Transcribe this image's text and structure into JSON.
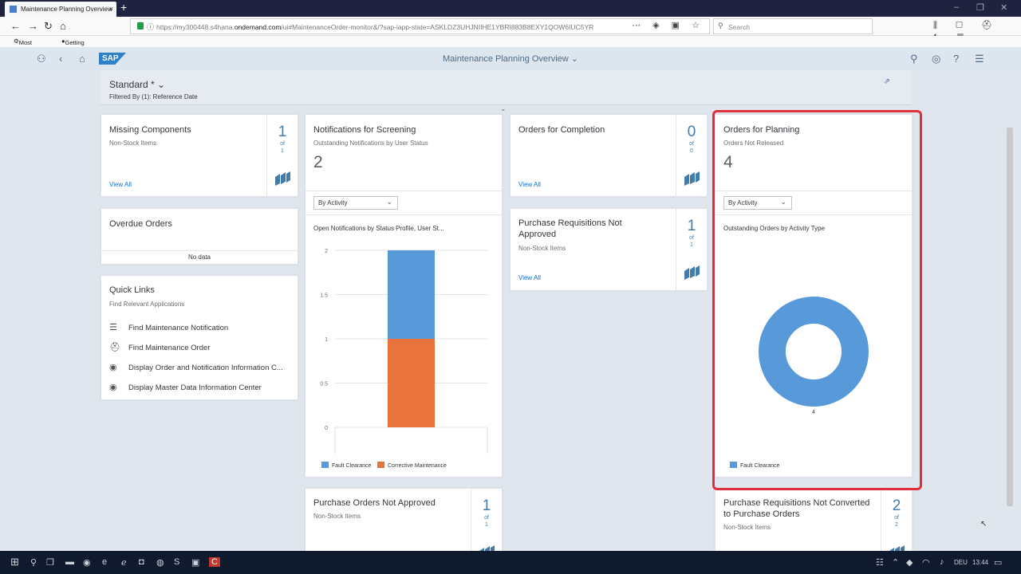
{
  "browser": {
    "tab_title": "Maintenance Planning Overview",
    "tab_close": "×",
    "new_tab": "+",
    "url_prefix": "https://my300448.s4hana.",
    "url_domain": "ondemand.com",
    "url_path": "/ui#MaintenanceOrder-monitor&/?sap-iapp-state=ASKLDZ3UHJNIIHE1YBRI883B8EXY1QOW6IUC5YR",
    "search_placeholder": "Search",
    "bookmarks": [
      "Most Visited",
      "Getting Started"
    ]
  },
  "shell": {
    "logo": "SAP",
    "title": "Maintenance Planning Overview"
  },
  "header": {
    "variant": "Standard *",
    "filter_text": "Filtered By (1): Reference Date"
  },
  "cards": {
    "missing_components": {
      "title": "Missing Components",
      "subtitle": "Non-Stock Items",
      "count": "1",
      "of": "of",
      "total": "1",
      "link": "View All"
    },
    "notifications": {
      "title": "Notifications for Screening",
      "subtitle": "Outstanding Notifications by User Status",
      "kpi": "2",
      "dropdown": "By Activity",
      "chart_title": "Open Notifications by Status Profile, User St..."
    },
    "orders_completion": {
      "title": "Orders for Completion",
      "count": "0",
      "of": "of",
      "total": "0",
      "link": "View All"
    },
    "orders_planning": {
      "title": "Orders for Planning",
      "subtitle": "Orders Not Released",
      "kpi": "4",
      "dropdown": "By Activity",
      "chart_title": "Outstanding Orders by Activity Type"
    },
    "overdue_orders": {
      "title": "Overdue Orders",
      "no_data": "No data"
    },
    "quick_links": {
      "title": "Quick Links",
      "subtitle": "Find Relevant Applications",
      "items": [
        {
          "label": "Find Maintenance Notification",
          "icon": "notification-icon"
        },
        {
          "label": "Find Maintenance Order",
          "icon": "order-icon"
        },
        {
          "label": "Display Order and Notification Information C...",
          "icon": "target-icon"
        },
        {
          "label": "Display Master Data Information Center",
          "icon": "target-icon"
        }
      ]
    },
    "purchase_requisitions": {
      "title": "Purchase Requisitions Not Approved",
      "subtitle": "Non-Stock Items",
      "count": "1",
      "of": "of",
      "total": "1",
      "link": "View All"
    },
    "purchase_orders": {
      "title": "Purchase Orders Not Approved",
      "subtitle": "Non-Stock Items",
      "count": "1",
      "of": "of",
      "total": "1"
    },
    "pr_not_converted": {
      "title": "Purchase Requisitions Not Converted to Purchase Orders",
      "subtitle": "Non-Stock Items",
      "count": "2",
      "of": "of",
      "total": "2"
    }
  },
  "colors": {
    "fault_clearance": "#5899da",
    "corrective_maintenance": "#e8743b",
    "highlight": "#e0303c"
  },
  "chart_data": [
    {
      "type": "bar",
      "stacked": true,
      "categories": [
        ""
      ],
      "series": [
        {
          "name": "Corrective Maintenance",
          "values": [
            1
          ]
        },
        {
          "name": "Fault Clearance",
          "values": [
            1
          ]
        }
      ],
      "ylim": [
        0,
        2
      ],
      "yticks": [
        "2",
        "1.5",
        "1",
        "0.5",
        "0"
      ],
      "legend": "bottom-left"
    },
    {
      "type": "pie",
      "donut": true,
      "slices": [
        {
          "name": "Fault Clearance",
          "value": 4
        }
      ],
      "data_label": "4",
      "legend": "bottom-left"
    }
  ],
  "taskbar": {
    "language": "DEU",
    "time": "13:44"
  }
}
